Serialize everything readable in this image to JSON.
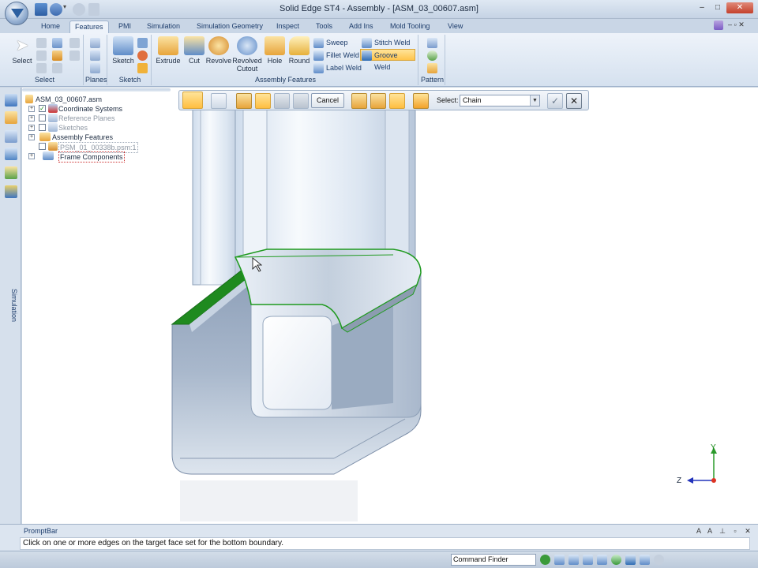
{
  "window": {
    "title": "Solid Edge ST4 - Assembly - [ASM_03_00607.asm]",
    "minimize_glyph": "–",
    "maximize_glyph": "□",
    "close_glyph": "✕"
  },
  "tabs": [
    {
      "label": "Home"
    },
    {
      "label": "Features"
    },
    {
      "label": "PMI"
    },
    {
      "label": "Simulation"
    },
    {
      "label": "Simulation Geometry"
    },
    {
      "label": "Inspect"
    },
    {
      "label": "Tools"
    },
    {
      "label": "Add Ins"
    },
    {
      "label": "Mold Tooling"
    },
    {
      "label": "View"
    }
  ],
  "active_tab": "Features",
  "ribbon": {
    "select_group": {
      "button": "Select",
      "label": "Select"
    },
    "planes_group": {
      "label": "Planes"
    },
    "sketch_group": {
      "button": "Sketch",
      "label": "Sketch"
    },
    "assembly_features": {
      "label": "Assembly Features",
      "extrude": "Extrude",
      "cut": "Cut",
      "revolve": "Revolve",
      "revolved_cutout_line1": "Revolved",
      "revolved_cutout_line2": "Cutout",
      "hole": "Hole",
      "round": "Round",
      "sweep": "Sweep",
      "fillet_weld": "Fillet Weld",
      "label_weld": "Label Weld",
      "stitch_weld": "Stitch Weld",
      "groove_weld": "Groove Weld"
    },
    "pattern_group": {
      "label": "Pattern"
    }
  },
  "tree": {
    "root": "ASM_03_00607.asm",
    "items": [
      {
        "label": "Coordinate Systems"
      },
      {
        "label": "Reference Planes"
      },
      {
        "label": "Sketches"
      },
      {
        "label": "Assembly Features"
      },
      {
        "label": "PSM_01_00338b.psm:1"
      },
      {
        "label": "Frame Components"
      }
    ]
  },
  "command_bar": {
    "cancel_label": "Cancel",
    "select_label": "Select:",
    "select_value": "Chain"
  },
  "side_tab": {
    "label": "Simulation"
  },
  "triad": {
    "y": "Y",
    "z": "Z"
  },
  "promptbar": {
    "title": "PromptBar",
    "text": "Click on one or more edges on the target face set for the bottom boundary."
  },
  "statusbar": {
    "command_finder": "Command Finder"
  },
  "colors": {
    "ribbon_bg": "#dbe6f3",
    "highlight": "#ffc44c",
    "edge_select": "#1f8a1f"
  }
}
